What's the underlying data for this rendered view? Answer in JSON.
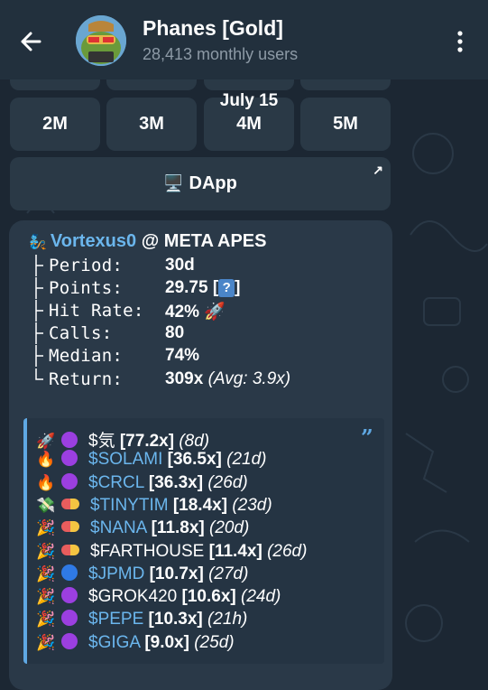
{
  "header": {
    "back_icon": "arrow-left-icon",
    "title": "Phanes [Gold]",
    "subtitle": "28,413 monthly users",
    "menu_icon": "more-vertical-icon"
  },
  "keyboard": {
    "date_label": "July 15",
    "buttons": [
      "2M",
      "3M",
      "4M",
      "5M"
    ],
    "dapp": {
      "icon": "desktop-icon",
      "label": "DApp",
      "link_icon": "arrow-up-right-icon"
    }
  },
  "message": {
    "user_icon": "genie-icon",
    "username": "Vortexus0",
    "group": "@ META APES",
    "stats": [
      {
        "label": "Period:",
        "value": "30d"
      },
      {
        "label": "Points:",
        "value": "29.75 [",
        "extra": "]"
      },
      {
        "label": "Hit Rate:",
        "value": "42%",
        "icon": "rocket-icon"
      },
      {
        "label": "Calls:",
        "value": "80"
      },
      {
        "label": "Median:",
        "value": "74%"
      },
      {
        "label": "Return:",
        "value": "309x",
        "avg": "(Avg: 3.9x)"
      }
    ],
    "tokens": [
      {
        "emoji": "🚀",
        "dot": "purple",
        "symbol": "$気",
        "mult": "[77.2x]",
        "age": "(8d)",
        "link": false
      },
      {
        "emoji": "🔥",
        "dot": "purple",
        "symbol": "$SOLAMI",
        "mult": "[36.5x]",
        "age": "(21d)",
        "link": true
      },
      {
        "emoji": "🔥",
        "dot": "purple",
        "symbol": "$CRCL",
        "mult": "[36.3x]",
        "age": "(26d)",
        "link": true
      },
      {
        "emoji": "💸",
        "dot": "pill",
        "symbol": "$TINYTIM",
        "mult": "[18.4x]",
        "age": "(23d)",
        "link": true
      },
      {
        "emoji": "🎉",
        "dot": "pill",
        "symbol": "$NANA",
        "mult": "[11.8x]",
        "age": "(20d)",
        "link": true
      },
      {
        "emoji": "🎉",
        "dot": "pill",
        "symbol": "$FARTHOUSE",
        "mult": "[11.4x]",
        "age": "(26d)",
        "link": false
      },
      {
        "emoji": "🎉",
        "dot": "blue",
        "symbol": "$JPMD",
        "mult": "[10.7x]",
        "age": "(27d)",
        "link": true
      },
      {
        "emoji": "🎉",
        "dot": "purple",
        "symbol": "$GROK420",
        "mult": "[10.6x]",
        "age": "(24d)",
        "link": false
      },
      {
        "emoji": "🎉",
        "dot": "purple",
        "symbol": "$PEPE",
        "mult": "[10.3x]",
        "age": "(21h)",
        "link": true
      },
      {
        "emoji": "🎉",
        "dot": "purple",
        "symbol": "$GIGA",
        "mult": "[9.0x]",
        "age": "(25d)",
        "link": true
      }
    ]
  },
  "colors": {
    "background": "#1c2733",
    "header": "#22303d",
    "button": "#2a3946",
    "link": "#6bb6ed",
    "quote_bar": "#5fa8e3"
  }
}
